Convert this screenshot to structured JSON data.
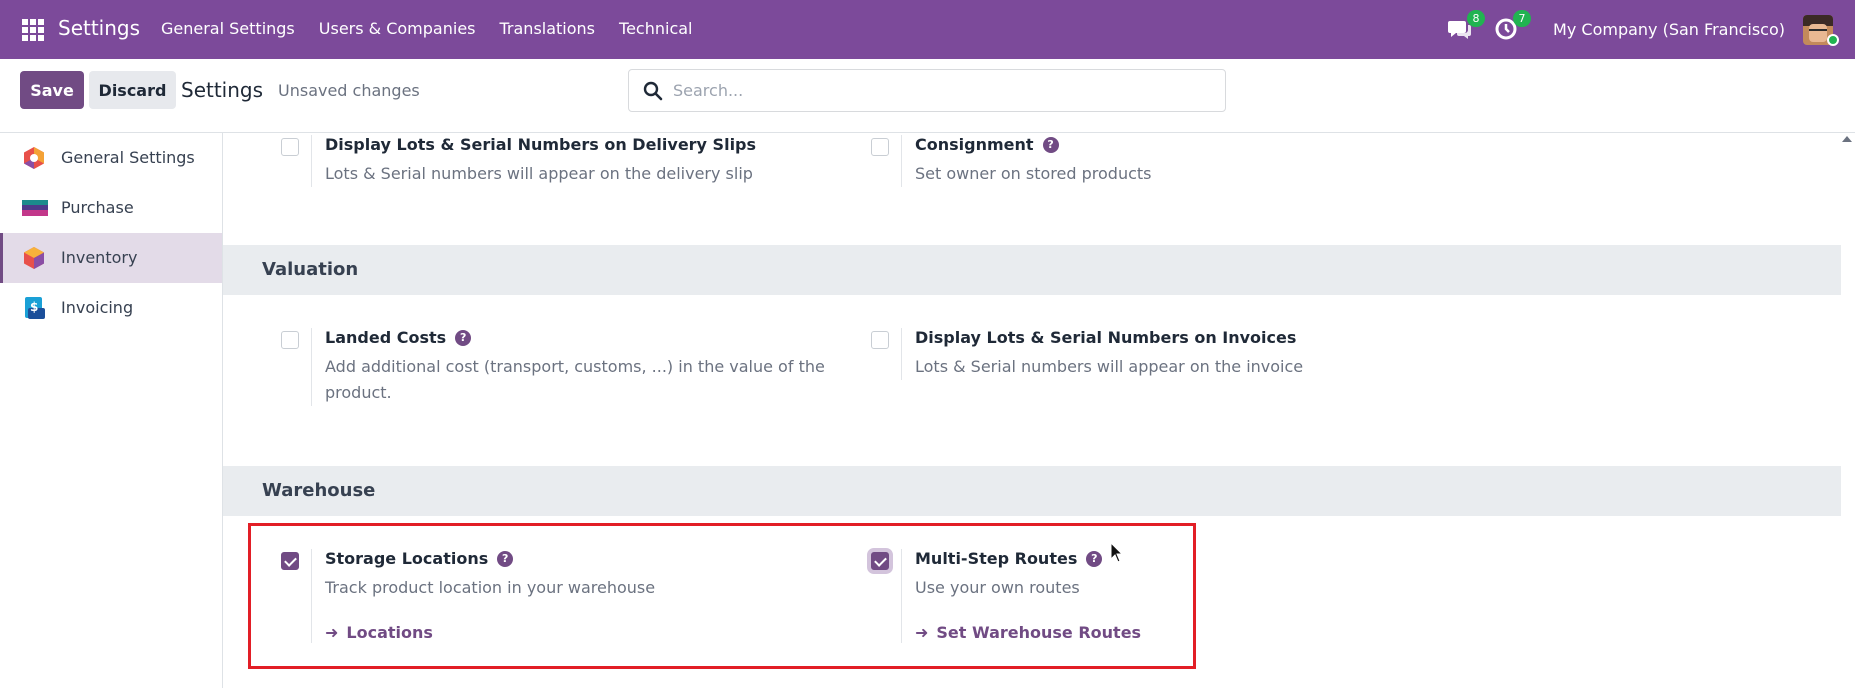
{
  "navbar": {
    "app_title": "Settings",
    "menu": [
      "General Settings",
      "Users & Companies",
      "Translations",
      "Technical"
    ],
    "messages_count": "8",
    "activities_count": "7",
    "company": "My Company (San Francisco)",
    "color": "#7c4a9a"
  },
  "control": {
    "save_label": "Save",
    "discard_label": "Discard",
    "title": "Settings",
    "status": "Unsaved changes",
    "search_placeholder": "Search..."
  },
  "sidebar": {
    "items": [
      {
        "label": "General Settings",
        "icon": "general-settings-icon",
        "active": false
      },
      {
        "label": "Purchase",
        "icon": "purchase-icon",
        "active": false
      },
      {
        "label": "Inventory",
        "icon": "inventory-icon",
        "active": true
      },
      {
        "label": "Invoicing",
        "icon": "invoicing-icon",
        "active": false
      }
    ]
  },
  "main": {
    "top_settings": [
      {
        "title": "Display Lots & Serial Numbers on Delivery Slips",
        "desc": "Lots & Serial numbers will appear on the delivery slip",
        "checked": false,
        "help": false
      },
      {
        "title": "Consignment",
        "desc": "Set owner on stored products",
        "checked": false,
        "help": true
      }
    ],
    "valuation": {
      "heading": "Valuation",
      "settings": [
        {
          "title": "Landed Costs",
          "desc": "Add additional cost (transport, customs, ...) in the value of the product.",
          "checked": false,
          "help": true
        },
        {
          "title": "Display Lots & Serial Numbers on Invoices",
          "desc": "Lots & Serial numbers will appear on the invoice",
          "checked": false,
          "help": false
        }
      ]
    },
    "warehouse": {
      "heading": "Warehouse",
      "settings": [
        {
          "title": "Storage Locations",
          "desc": "Track product location in your warehouse",
          "checked": true,
          "help": true,
          "link": "Locations"
        },
        {
          "title": "Multi-Step Routes",
          "desc": "Use your own routes",
          "checked": true,
          "help": true,
          "link": "Set Warehouse Routes"
        }
      ]
    },
    "accent": "#714b84",
    "highlight": "#e21e26"
  }
}
